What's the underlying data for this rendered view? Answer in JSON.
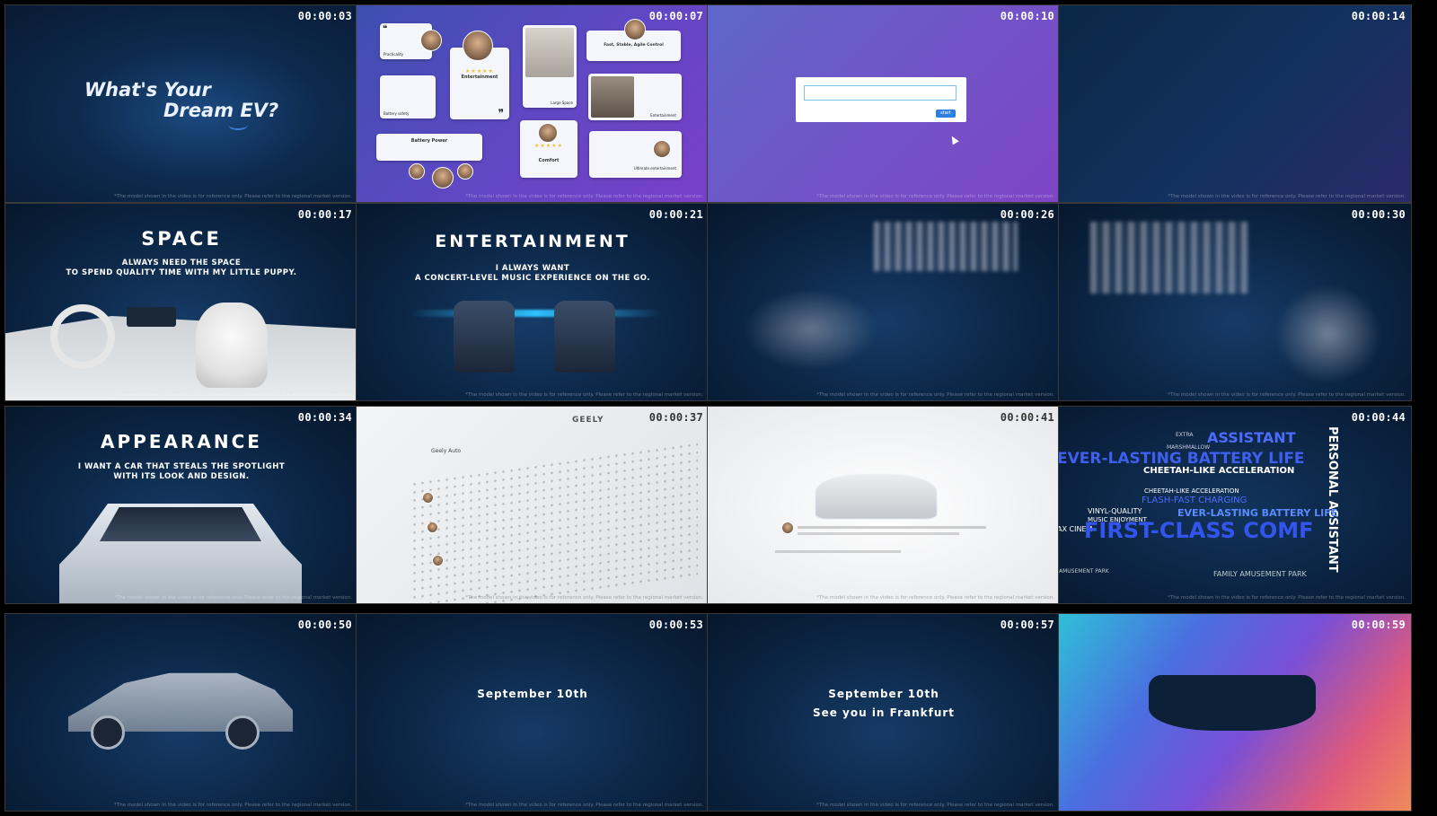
{
  "tiles": [
    {
      "timestamp": "00:00:03",
      "title_line1": "What's Your",
      "title_line2": "Dream EV?"
    },
    {
      "timestamp": "00:00:07",
      "cards": {
        "practicality": "Practicality",
        "battery_safety": "Battery safety",
        "entertainment": "Entertainment",
        "large_space": "Large Space",
        "fast_stable": "Fast, Stable, Agile Control",
        "entertainment2": "Entertainment",
        "battery_power": "Battery Power",
        "comfort": "Comfort",
        "ultimate_entertainment": "Ultimate entertainment"
      }
    },
    {
      "timestamp": "00:00:10",
      "start_label": "start",
      "input_value": ""
    },
    {
      "timestamp": "00:00:14"
    },
    {
      "timestamp": "00:00:17",
      "title": "SPACE",
      "sub1": "ALWAYS NEED THE SPACE",
      "sub2": "TO SPEND QUALITY TIME WITH MY LITTLE PUPPY."
    },
    {
      "timestamp": "00:00:21",
      "title": "ENTERTAINMENT",
      "sub1": "I ALWAYS WANT",
      "sub2": "A CONCERT-LEVEL MUSIC EXPERIENCE ON THE GO."
    },
    {
      "timestamp": "00:00:26"
    },
    {
      "timestamp": "00:00:30"
    },
    {
      "timestamp": "00:00:34",
      "title": "APPEARANCE",
      "sub1": "I WANT A CAR THAT STEALS THE SPOTLIGHT",
      "sub2": "WITH ITS LOOK AND DESIGN."
    },
    {
      "timestamp": "00:00:37",
      "brand": "GEELY",
      "post_author": "Geely Auto"
    },
    {
      "timestamp": "00:00:41"
    },
    {
      "timestamp": "00:00:44",
      "words": {
        "assistant": "ASSISTANT",
        "lasting": "EVER-LASTING BATTERY LIFE",
        "cheetah": "CHEETAH-LIKE ACCELERATION",
        "cheetah2": "CHEETAH-LIKE ACCELERATION",
        "flash": "FLASH-FAST CHARGING",
        "lasting2": "EVER-LASTING BATTERY LIFE",
        "vinyl": "VINYL-QUALITY",
        "music": "MUSIC ENJOYMENT",
        "firstclass": "FIRST-CLASS COMF",
        "family": "FAMILY AMUSEMENT PARK",
        "amusement": "AMUSEMENT PARK",
        "personal": "PERSONAL ASSISTANT",
        "extra": "EXTRA",
        "marshmallow": "MARSHMALLOW",
        "cinema": "AX CINEM"
      }
    },
    {
      "timestamp": "00:00:50"
    },
    {
      "timestamp": "00:00:53",
      "date": "September 10th"
    },
    {
      "timestamp": "00:00:57",
      "date": "September 10th",
      "tagline": "See you in Frankfurt"
    },
    {
      "timestamp": "00:00:59"
    }
  ],
  "disclaimer": "*The model shown in the video is for reference only. Please refer to the regional market version."
}
